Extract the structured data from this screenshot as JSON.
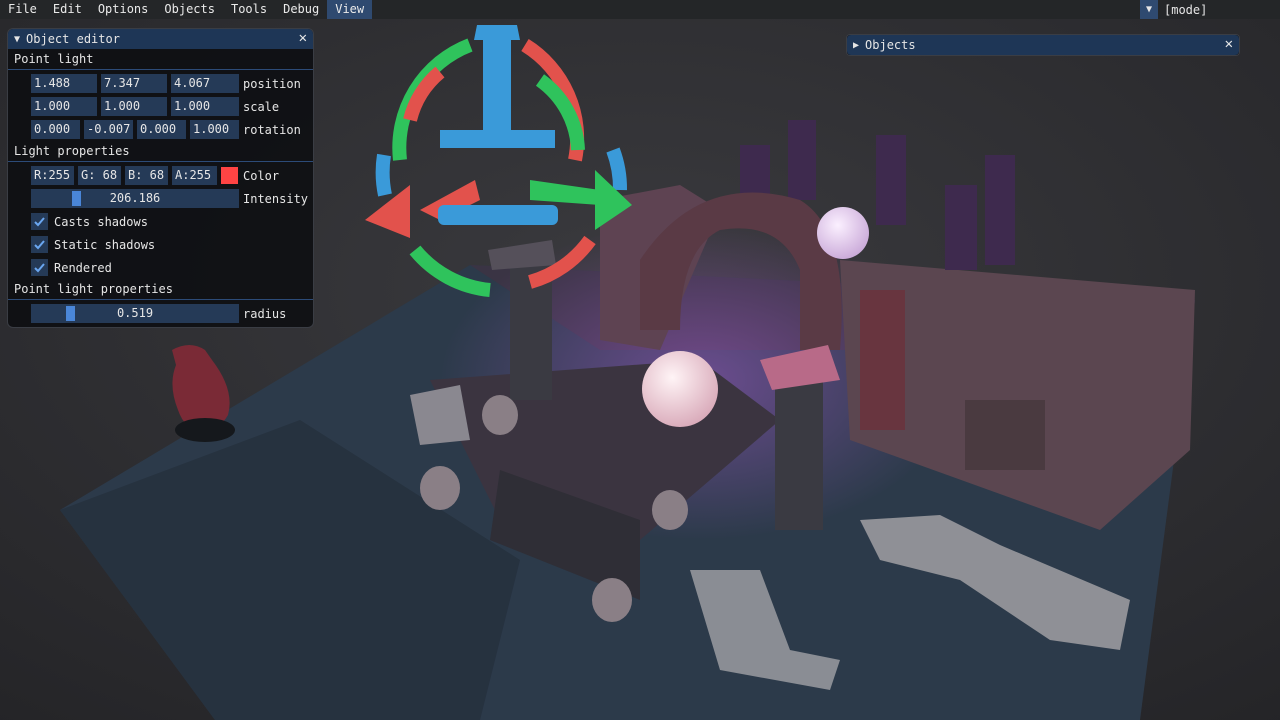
{
  "menubar": {
    "items": [
      "File",
      "Edit",
      "Options",
      "Objects",
      "Tools",
      "Debug",
      "View"
    ],
    "mode_label": "[mode]"
  },
  "object_editor": {
    "title": "Object editor",
    "section_point_light": "Point light",
    "position": {
      "values": [
        "1.488",
        "7.347",
        "4.067"
      ],
      "label": "position"
    },
    "scale": {
      "values": [
        "1.000",
        "1.000",
        "1.000"
      ],
      "label": "scale"
    },
    "rotation": {
      "values": [
        "0.000",
        "-0.007",
        "0.000",
        "1.000"
      ],
      "label": "rotation"
    },
    "section_light_properties": "Light properties",
    "color": {
      "r": "R:255",
      "g": "G: 68",
      "b": "B: 68",
      "a": "A:255",
      "label": "Color",
      "swatch": "#ff4444"
    },
    "intensity": {
      "value": "206.186",
      "label": "Intensity",
      "fraction": 0.2
    },
    "checkboxes": [
      {
        "label": "Casts shadows",
        "checked": true
      },
      {
        "label": "Static shadows",
        "checked": true
      },
      {
        "label": "Rendered",
        "checked": true
      }
    ],
    "section_point_light_properties": "Point light properties",
    "radius": {
      "value": "0.519",
      "label": "radius",
      "fraction": 0.17
    }
  },
  "objects_panel": {
    "title": "Objects"
  },
  "colors": {
    "title_bg": "#1e3656",
    "field_bg": "#253a57",
    "accent": "#4a86d8",
    "gizmo_red": "#e2524c",
    "gizmo_green": "#2fc35c",
    "gizmo_blue": "#3a9ad9"
  }
}
